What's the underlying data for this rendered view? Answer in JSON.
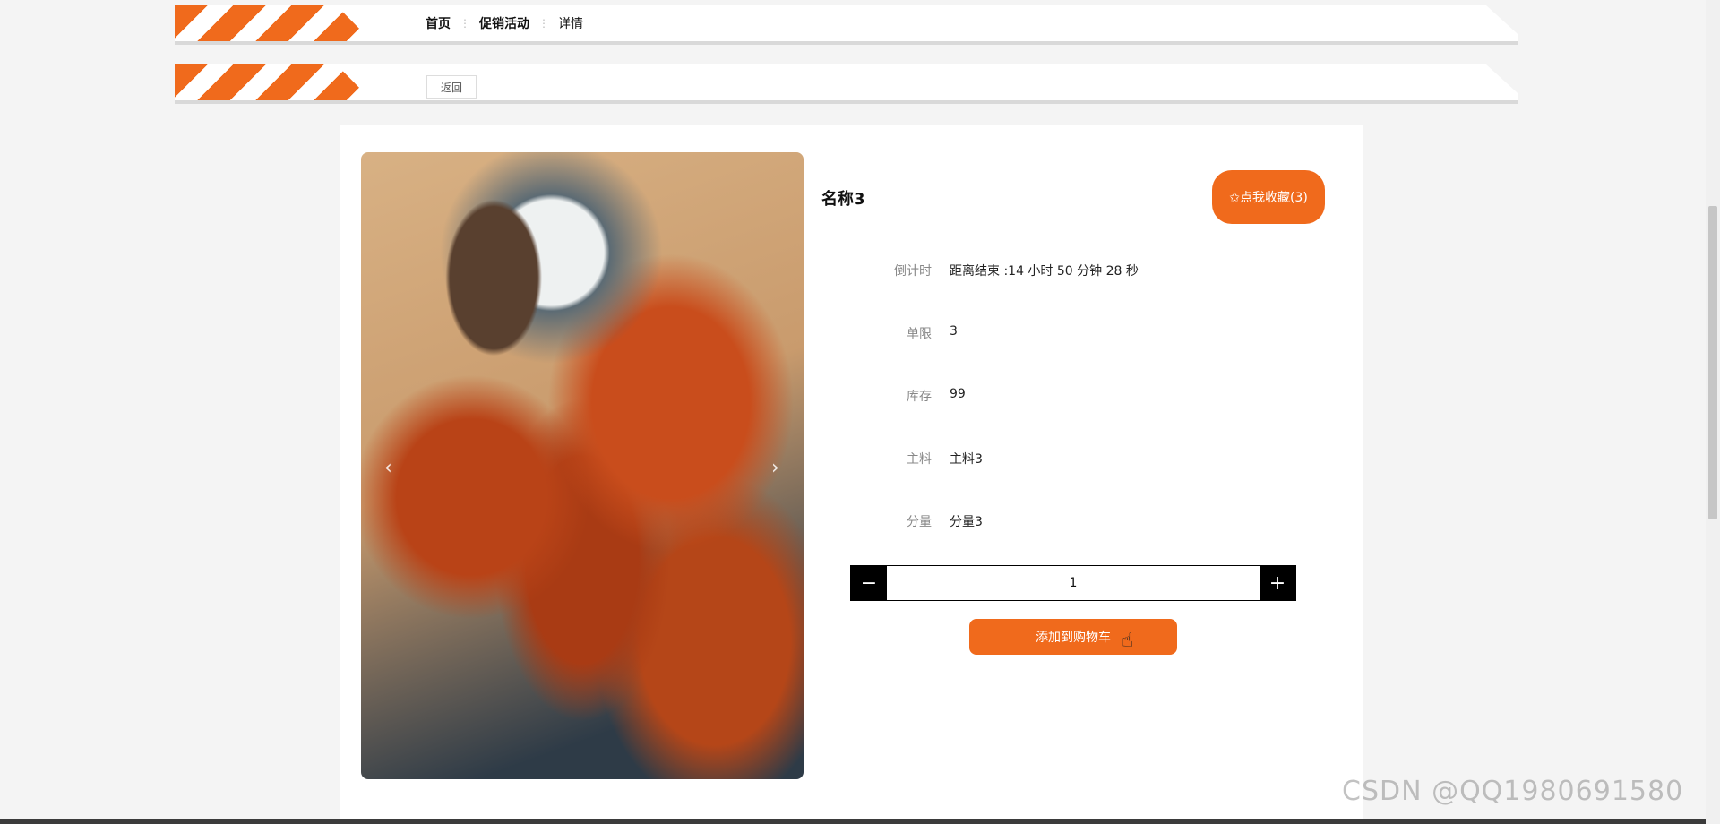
{
  "breadcrumb": {
    "home": "首页",
    "sep1": "⋮",
    "promo": "促销活动",
    "sep2": "⋮",
    "detail": "详情"
  },
  "actions": {
    "back_label": "返回"
  },
  "product": {
    "title": "名称3",
    "favorite_label": "✩点我收藏(3)",
    "fields": [
      {
        "label": "倒计时",
        "value": "距离结束 :14 小时 50 分钟 28 秒"
      },
      {
        "label": "单限",
        "value": "3"
      },
      {
        "label": "库存",
        "value": "99"
      },
      {
        "label": "主料",
        "value": "主料3"
      },
      {
        "label": "分量",
        "value": "分量3"
      }
    ],
    "quantity": "1",
    "minus_symbol": "−",
    "plus_symbol": "+",
    "add_to_cart_label": "添加到购物车",
    "prev_symbol": "‹",
    "next_symbol": "›"
  },
  "watermark": "CSDN @QQ1980691580",
  "colors": {
    "accent": "#f06a1c",
    "background": "#f4f4f4"
  },
  "icons": {
    "favorite": "star-outline-icon",
    "cursor": "hand-pointer-icon"
  }
}
